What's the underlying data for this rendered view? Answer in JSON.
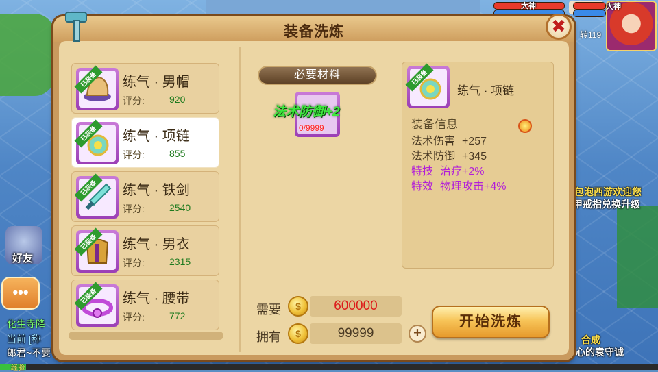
{
  "panel": {
    "title": "装备洗炼",
    "close_label": "✖"
  },
  "equipment_list": [
    {
      "name": "练气 · 男帽",
      "score_label": "评分:",
      "score": "920",
      "badge": "已装备",
      "icon": "hat-icon",
      "selected": false
    },
    {
      "name": "练气 · 项链",
      "score_label": "评分:",
      "score": "855",
      "badge": "已装备",
      "icon": "necklace-icon",
      "selected": true
    },
    {
      "name": "练气 · 铁剑",
      "score_label": "评分:",
      "score": "2540",
      "badge": "已装备",
      "icon": "sword-icon",
      "selected": false
    },
    {
      "name": "练气 · 男衣",
      "score_label": "评分:",
      "score": "2315",
      "badge": "已装备",
      "icon": "armor-icon",
      "selected": false
    },
    {
      "name": "练气 · 腰带",
      "score_label": "评分:",
      "score": "772",
      "badge": "已装备",
      "icon": "belt-icon",
      "selected": false
    }
  ],
  "materials": {
    "header": "必要材料",
    "item_name": "法术防御+2",
    "count": "0/9999"
  },
  "info": {
    "item_name": "练气 · 项链",
    "badge": "已装备",
    "section_title": "装备信息",
    "stats": [
      {
        "label": "法术伤害",
        "value": "+257",
        "highlight": false
      },
      {
        "label": "法术防御",
        "value": "+345",
        "highlight": false
      },
      {
        "label": "特技",
        "value": "治疗+2%",
        "highlight": true
      },
      {
        "label": "特效",
        "value": "物理攻击+4%",
        "highlight": true
      }
    ]
  },
  "cost": {
    "need_label": "需要",
    "need_value": "600000",
    "have_label": "拥有",
    "have_value": "99999",
    "plus_label": "+",
    "coin_glyph": "$"
  },
  "start_button": "开始洗炼",
  "hud": {
    "dashen_left": "大神",
    "dashen_right": "大神",
    "zhuan": "转119",
    "friend": "好友",
    "chat_btn": "•••",
    "chat_lines": [
      "化生寺降",
      "当前 [称",
      "郎君~不要"
    ],
    "scene_texts": [
      "包泡西游欢迎您",
      "甲戒指兑换升级",
      "合成",
      "心的袁守诚"
    ],
    "exp_label": "经验",
    "exp_fraction": 0.04
  },
  "colors": {
    "score_green": "#1e7a1e",
    "need_red": "#dd1a1a",
    "material_green": "#3ee83e",
    "highlight_purple": "#b21fd8",
    "slot_purple": "#9b3fb6",
    "badge_green": "#2e9b2e"
  }
}
